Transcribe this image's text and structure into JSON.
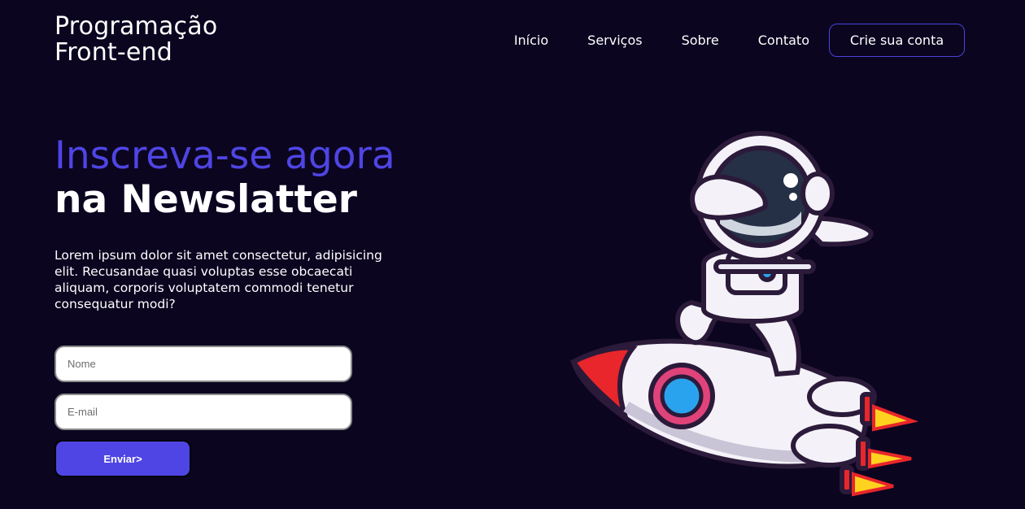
{
  "header": {
    "logo_line1": "Programação",
    "logo_line2": "Front-end",
    "nav": {
      "inicio": "Início",
      "servicos": "Serviços",
      "sobre": "Sobre",
      "contato": "Contato"
    },
    "cta_label": "Crie sua conta"
  },
  "hero": {
    "title_accent": "Inscreva-se agora",
    "title_main": "na Newslatter",
    "description": "Lorem ipsum dolor sit amet consectetur, adipisicing elit. Recusandae quasi voluptas esse obcaecati aliquam, corporis voluptatem commodi tenetur consequatur modi?"
  },
  "form": {
    "name_placeholder": "Nome",
    "email_placeholder": "E-mail",
    "submit_label": "Enviar>"
  },
  "illustration": {
    "icon": "astronaut-on-rocket-illustration",
    "colors": {
      "accent": "#4f45e4",
      "background": "#0b0520",
      "rocket_nose": "#e8262b",
      "window": "#2aa3ee",
      "flame": "#ffd21f"
    }
  }
}
